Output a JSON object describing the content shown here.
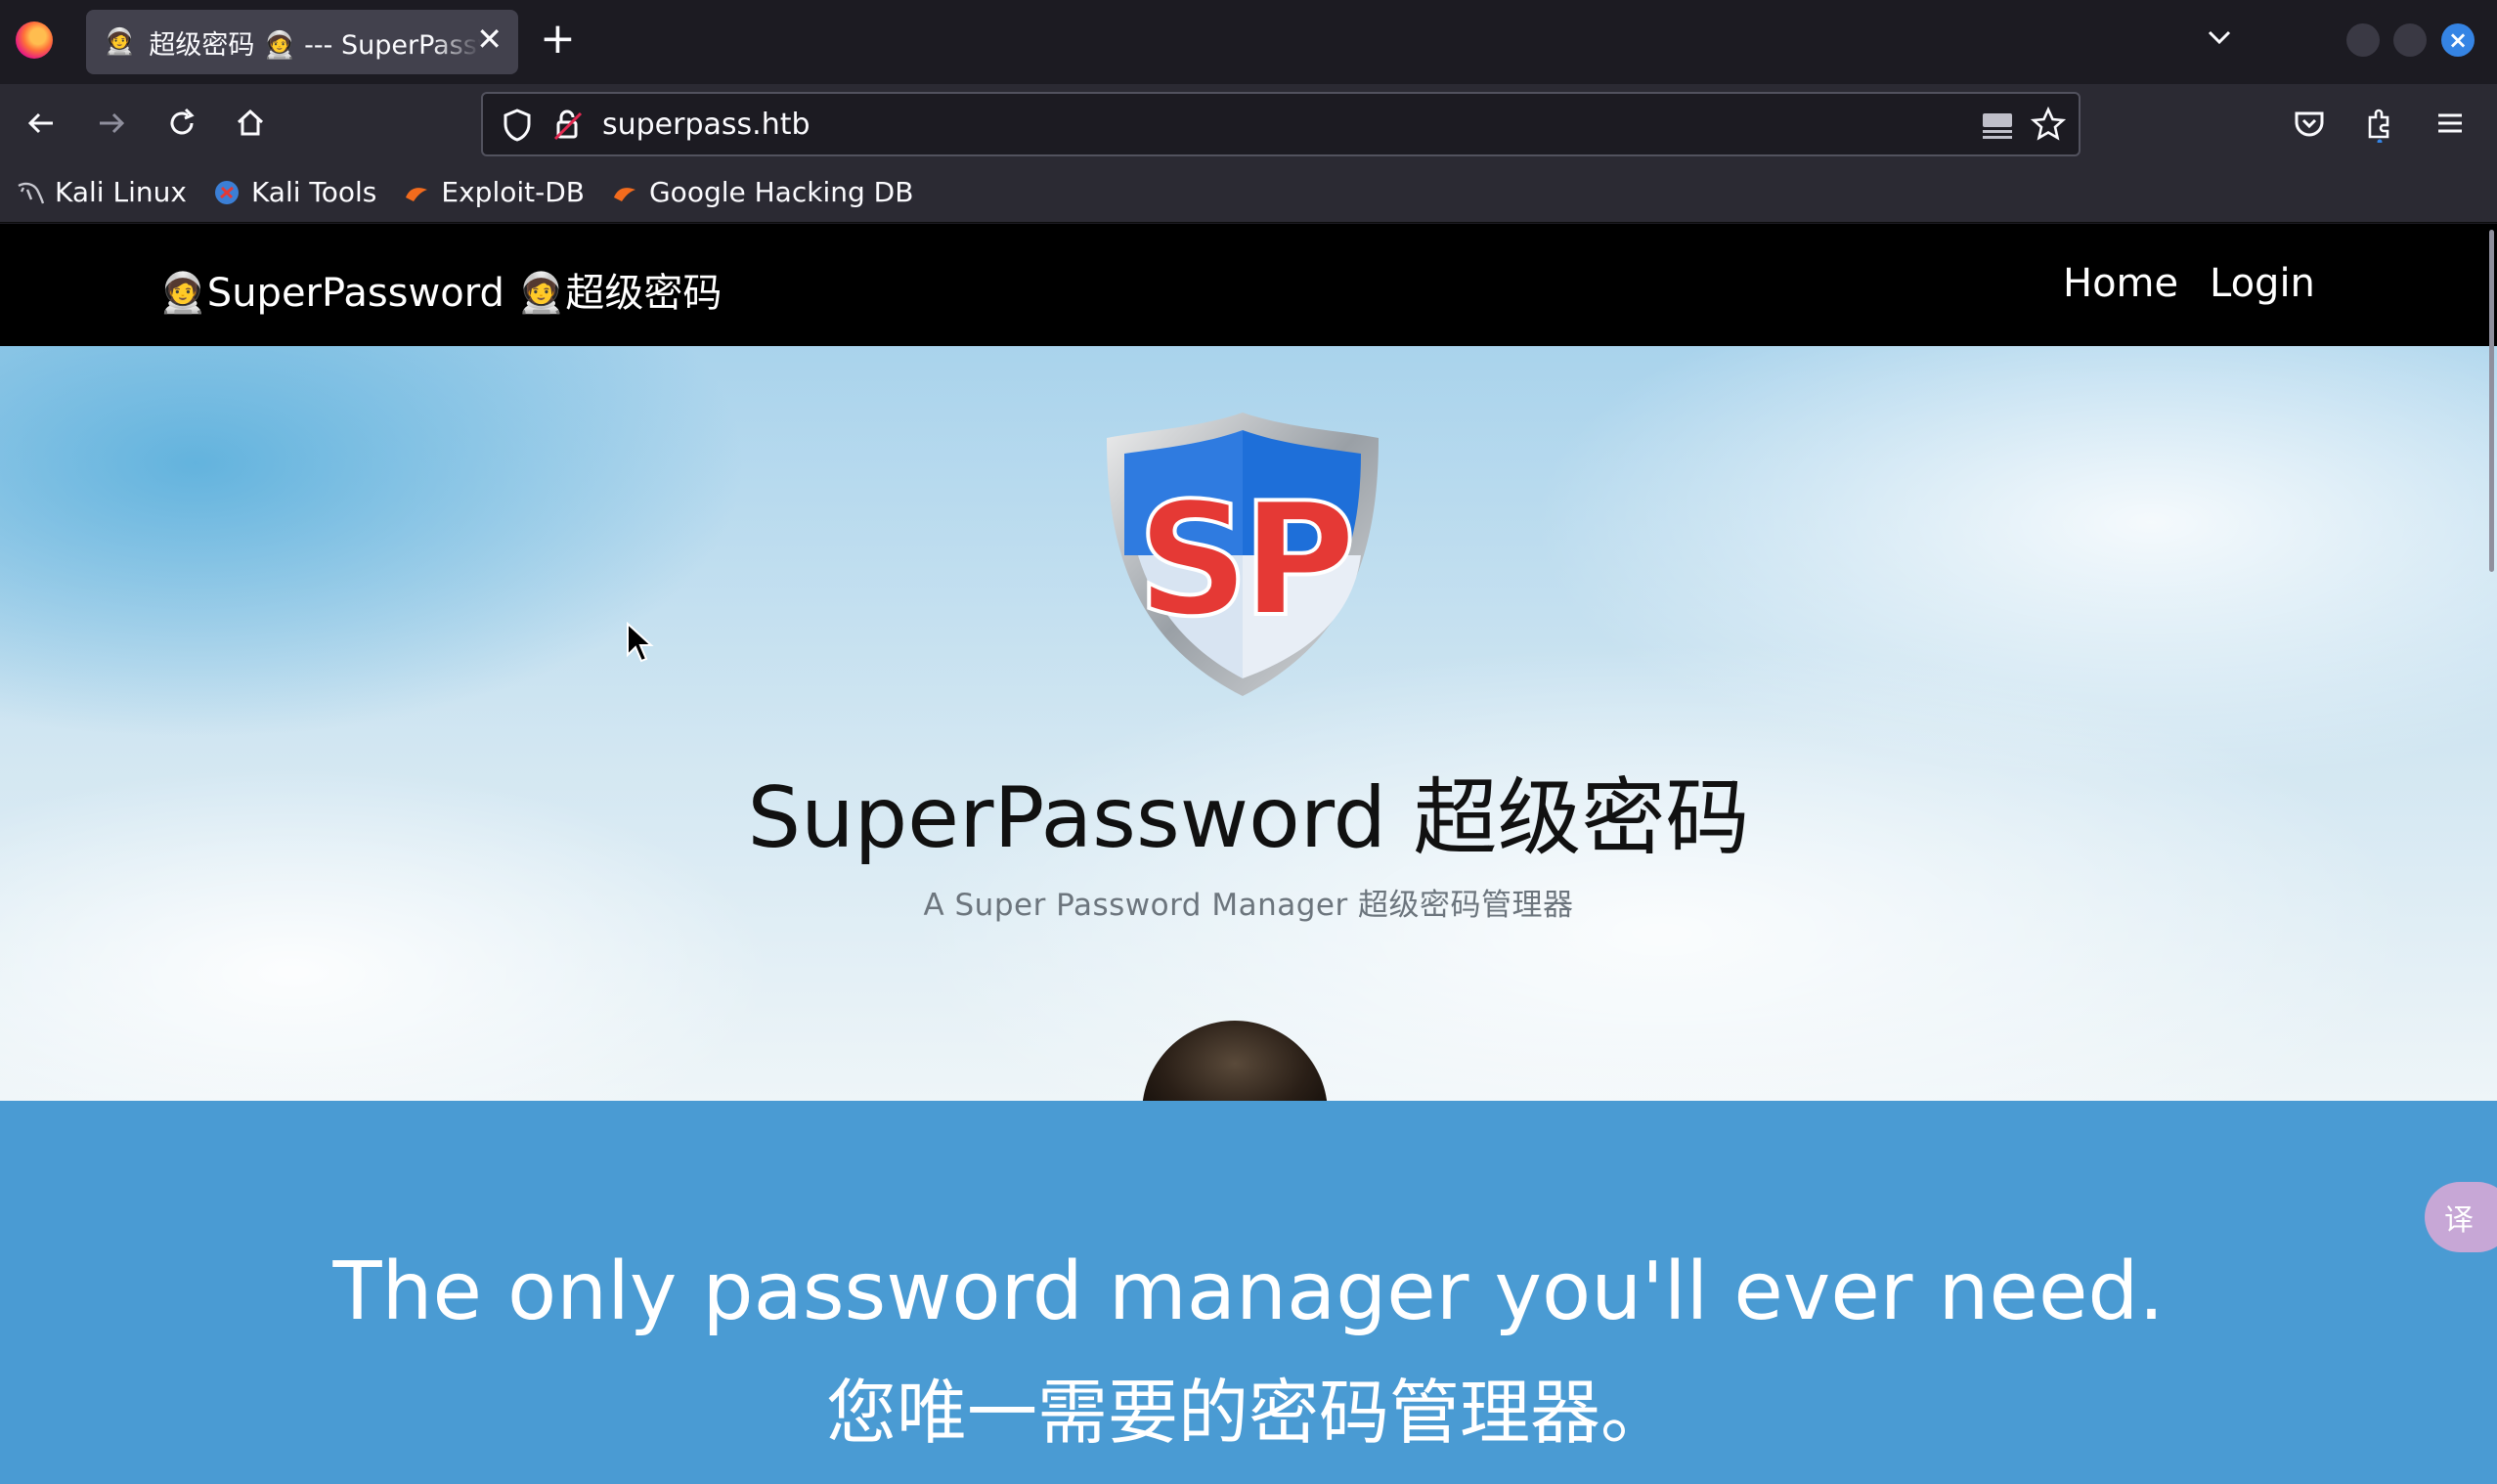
{
  "browser": {
    "tab": {
      "favicon": "🧑‍🚀",
      "title": "超级密码 🧑‍🚀 --- SuperPassword",
      "close": "✕"
    },
    "new_tab": "+",
    "url": "superpass.htb",
    "bookmarks": [
      {
        "label": "Kali Linux",
        "icon": "kali-dragon-icon"
      },
      {
        "label": "Kali Tools",
        "icon": "kali-tools-icon"
      },
      {
        "label": "Exploit-DB",
        "icon": "exploit-db-icon"
      },
      {
        "label": "Google Hacking DB",
        "icon": "ghdb-icon"
      }
    ]
  },
  "site": {
    "brand": "🧑‍🚀SuperPassword 🧑‍🚀超级密码",
    "nav": {
      "home": "Home",
      "login": "Login"
    },
    "logo_text": "SP",
    "hero": {
      "title": "SuperPassword 超级密码",
      "subtitle": "A Super Password Manager 超级密码管理器"
    },
    "band": {
      "line1": "The only password manager you'll ever need.",
      "line2": "您唯一需要的密码管理器。"
    },
    "translate_fab": "译"
  },
  "colors": {
    "chrome_dark": "#1c1b22",
    "toolbar": "#2b2a33",
    "site_nav": "#000000",
    "band": "#4a9bd3",
    "logo_red": "#e53935",
    "logo_blue": "#1e6fd9"
  }
}
